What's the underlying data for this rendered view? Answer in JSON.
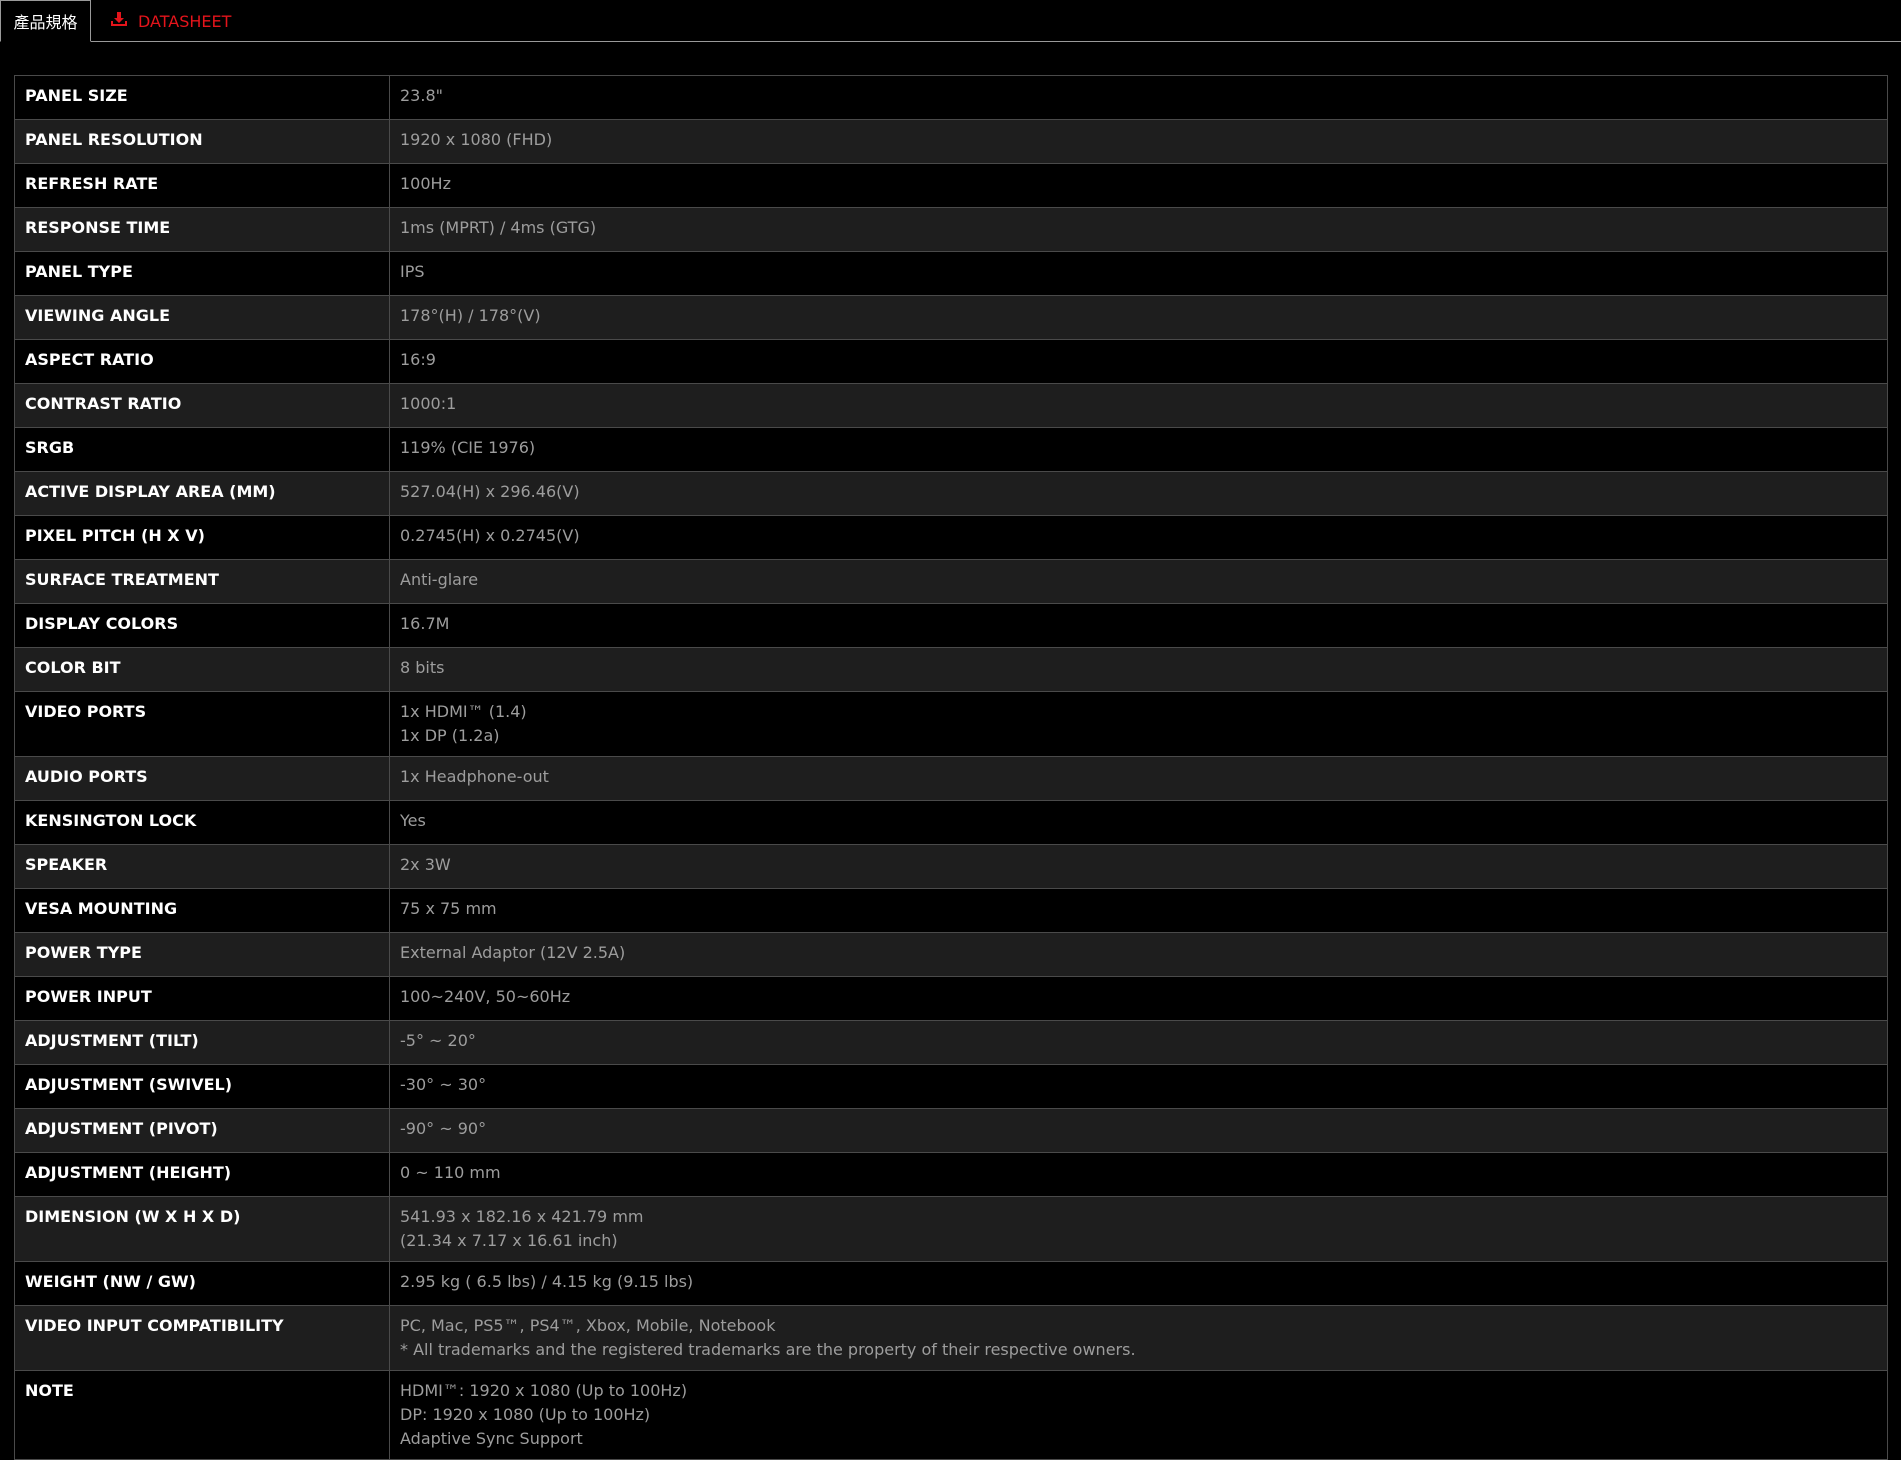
{
  "tabs": {
    "specs_label": "產品規格",
    "datasheet_label": "DATASHEET",
    "datasheet_icon": "download-icon",
    "accent_color": "#e4141b"
  },
  "specs": [
    {
      "label": "PANEL SIZE",
      "lines": [
        "23.8\""
      ]
    },
    {
      "label": "PANEL RESOLUTION",
      "lines": [
        "1920 x 1080 (FHD)"
      ]
    },
    {
      "label": "REFRESH RATE",
      "lines": [
        "100Hz"
      ]
    },
    {
      "label": "RESPONSE TIME",
      "lines": [
        "1ms (MPRT) / 4ms (GTG)"
      ]
    },
    {
      "label": "PANEL TYPE",
      "lines": [
        "IPS"
      ]
    },
    {
      "label": "VIEWING ANGLE",
      "lines": [
        "178°(H) / 178°(V)"
      ]
    },
    {
      "label": "ASPECT RATIO",
      "lines": [
        "16:9"
      ]
    },
    {
      "label": "CONTRAST RATIO",
      "lines": [
        "1000:1"
      ]
    },
    {
      "label": "SRGB",
      "lines": [
        "119% (CIE 1976)"
      ]
    },
    {
      "label": "ACTIVE DISPLAY AREA (MM)",
      "lines": [
        "527.04(H) x 296.46(V)"
      ]
    },
    {
      "label": "PIXEL PITCH (H X V)",
      "lines": [
        "0.2745(H) x 0.2745(V)"
      ]
    },
    {
      "label": "SURFACE TREATMENT",
      "lines": [
        "Anti-glare"
      ]
    },
    {
      "label": "DISPLAY COLORS",
      "lines": [
        "16.7M"
      ]
    },
    {
      "label": "COLOR BIT",
      "lines": [
        "8 bits"
      ]
    },
    {
      "label": "VIDEO PORTS",
      "lines": [
        "1x HDMI™ (1.4)",
        "1x DP (1.2a)"
      ]
    },
    {
      "label": "AUDIO PORTS",
      "lines": [
        "1x Headphone-out"
      ]
    },
    {
      "label": "KENSINGTON LOCK",
      "lines": [
        "Yes"
      ]
    },
    {
      "label": "SPEAKER",
      "lines": [
        "2x 3W"
      ]
    },
    {
      "label": "VESA MOUNTING",
      "lines": [
        "75 x 75 mm"
      ]
    },
    {
      "label": "POWER TYPE",
      "lines": [
        "External Adaptor (12V 2.5A)"
      ]
    },
    {
      "label": "POWER INPUT",
      "lines": [
        "100~240V, 50~60Hz"
      ]
    },
    {
      "label": "ADJUSTMENT (TILT)",
      "lines": [
        "-5° ~ 20°"
      ]
    },
    {
      "label": "ADJUSTMENT (SWIVEL)",
      "lines": [
        "-30° ~ 30°"
      ]
    },
    {
      "label": "ADJUSTMENT (PIVOT)",
      "lines": [
        "-90° ~ 90°"
      ]
    },
    {
      "label": "ADJUSTMENT (HEIGHT)",
      "lines": [
        "0 ~ 110 mm"
      ]
    },
    {
      "label": "DIMENSION (W X H X D)",
      "lines": [
        "541.93 x 182.16 x 421.79 mm",
        "(21.34 x 7.17 x 16.61 inch)"
      ]
    },
    {
      "label": "WEIGHT (NW / GW)",
      "lines": [
        "2.95 kg ( 6.5 lbs) / 4.15 kg (9.15 lbs)"
      ]
    },
    {
      "label": "VIDEO INPUT COMPATIBILITY",
      "lines": [
        "PC, Mac, PS5™, PS4™, Xbox, Mobile, Notebook",
        "* All trademarks and the registered trademarks are the property of their respective owners."
      ]
    },
    {
      "label": "NOTE",
      "lines": [
        "HDMI™: 1920 x 1080 (Up to 100Hz)",
        "DP: 1920 x 1080 (Up to 100Hz)",
        "Adaptive Sync Support"
      ]
    }
  ]
}
